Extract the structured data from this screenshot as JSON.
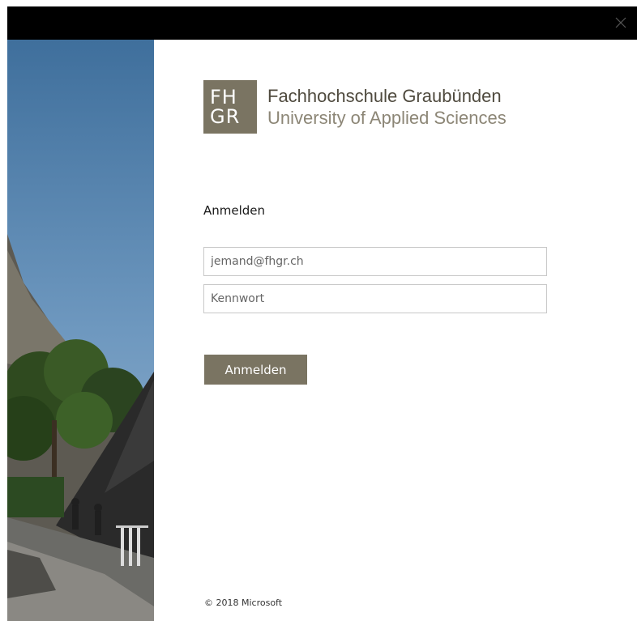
{
  "logo": {
    "mark_top": "FH",
    "mark_bottom": "GR",
    "name": "Fachhochschule Graubünden",
    "subtitle": "University of Applied Sciences"
  },
  "form": {
    "heading": "Anmelden",
    "email_placeholder": "jemand@fhgr.ch",
    "password_placeholder": "Kennwort",
    "submit_label": "Anmelden"
  },
  "footer": {
    "copyright": "© 2018 Microsoft"
  },
  "colors": {
    "accent": "#7a7462",
    "titlebar": "#000000"
  },
  "icons": {
    "close": "close-icon"
  }
}
